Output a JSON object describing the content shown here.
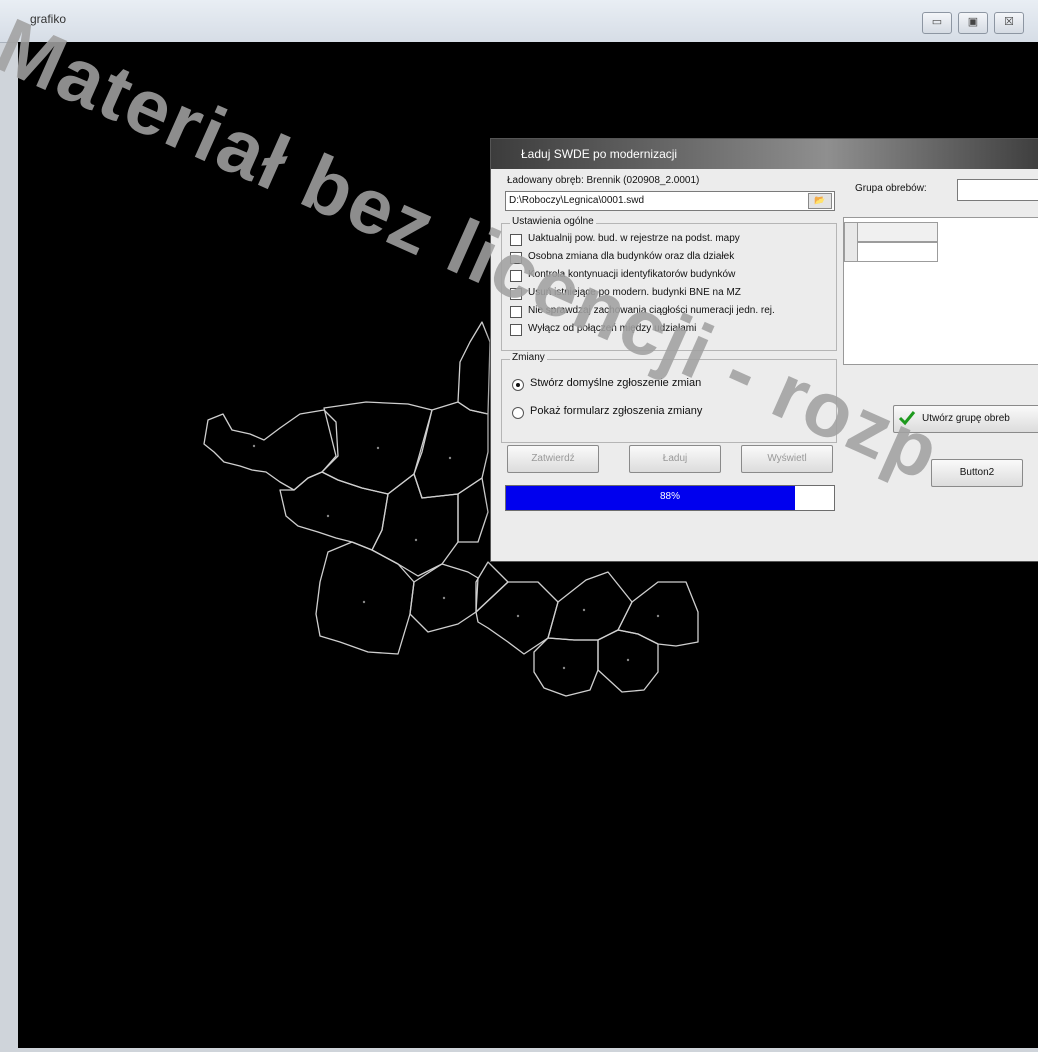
{
  "window": {
    "title": "grafiko",
    "buttons": [
      "▭",
      "▣",
      "☒"
    ]
  },
  "dialog": {
    "title": "Ładuj SWDE po modernizacji",
    "loaded_label": "Ładowany obręb: Brennik (020908_2.0001)",
    "path_value": "D:\\Roboczy\\Legnica\\0001.swd",
    "group_label": "Grupa obrebów:",
    "general_settings": {
      "legend": "Ustawienia ogólne",
      "options": [
        "Uaktualnij pow. bud. w rejestrze na podst. mapy",
        "Osobna zmiana dla budynków oraz dla działek",
        "Kontrola kontynuacji identyfikatorów budynków",
        "Usuń istniejące po modern. budynki BNE na MZ",
        "Nie sprawdzaj zachowania ciągłości numeracji jedn. rej.",
        "Wyłącz od połączeń między udziałami"
      ]
    },
    "changes": {
      "legend": "Zmiany",
      "options": [
        "Stwórz domyślne zgłoszenie zmian",
        "Pokaż formularz zgłoszenia zmiany"
      ],
      "selected": 0
    },
    "buttons": {
      "save": "Zatwierdź",
      "load": "Ładuj",
      "export": "Wyświetl",
      "create_group": "Utwórz grupę obreb",
      "button2": "Button2"
    },
    "progress": {
      "value": 0.88,
      "text": "88%"
    }
  },
  "watermark": "Materiał bez licencji - rozp",
  "colors": {
    "canvas": "#000000",
    "progress": "#0000ee",
    "map_lines": "#cfcfcf"
  }
}
